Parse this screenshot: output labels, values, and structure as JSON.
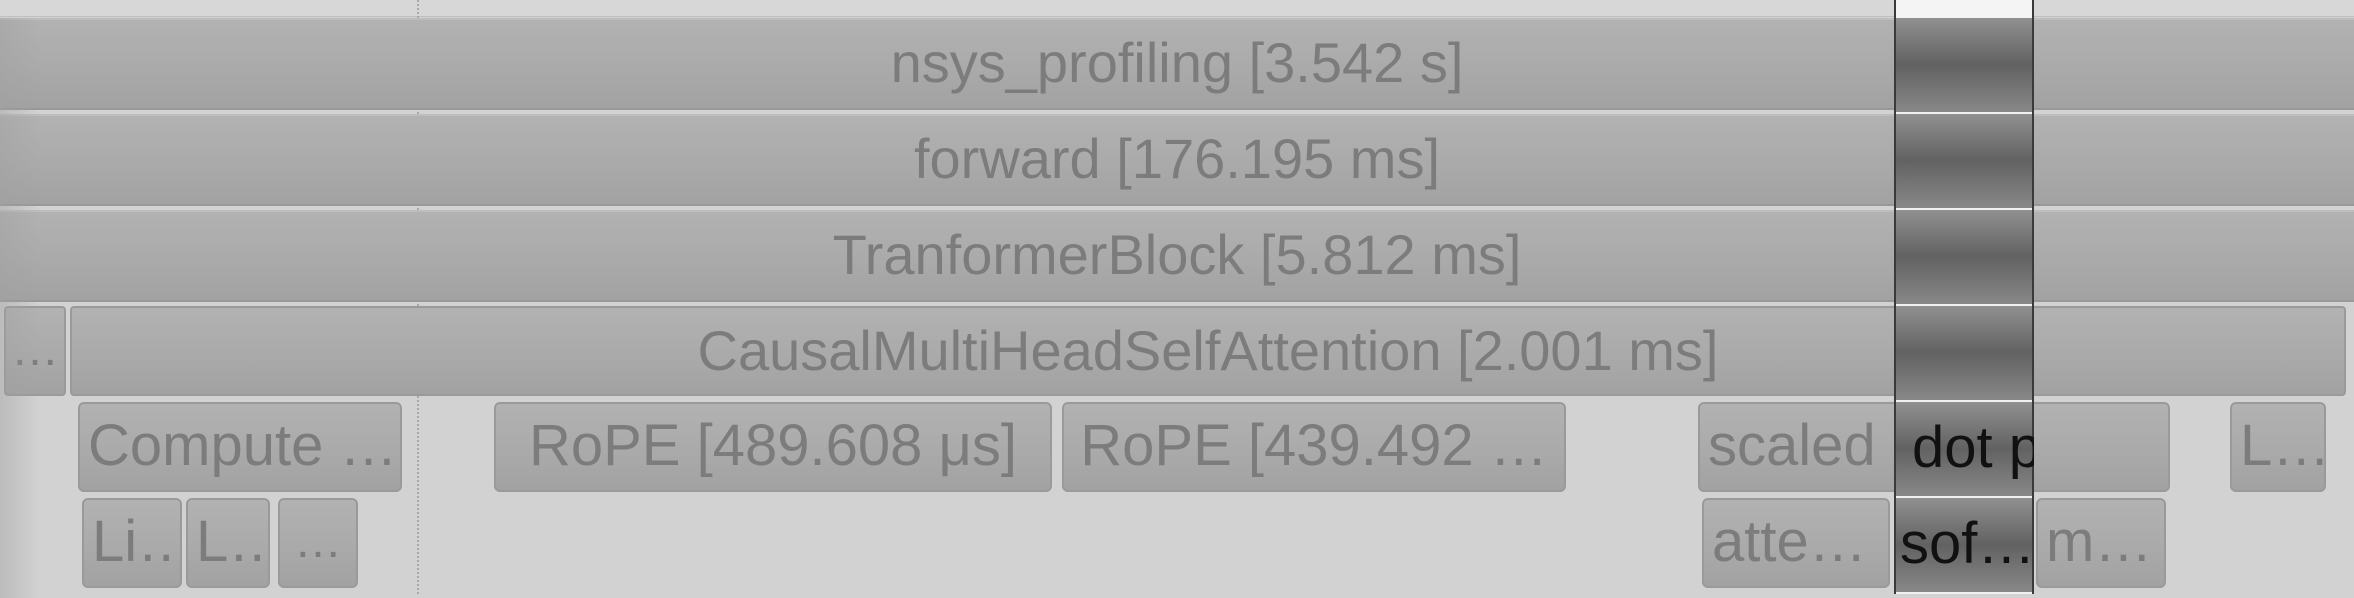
{
  "rows": {
    "nsys_profiling": "nsys_profiling [3.542 s]",
    "forward": "forward [176.195 ms]",
    "transformer_block": "TranformerBlock [5.812 ms]",
    "attention_prefix": "…",
    "attention": "CausalMultiHeadSelfAttention [2.001 ms]"
  },
  "row5": {
    "compute": "Compute …",
    "rope1": "RoPE [489.608 μs]",
    "rope2": "RoPE [439.492 …",
    "scaled_prefix": "scaled",
    "scaled_highlight": "dot pro…",
    "last": "L…"
  },
  "row6": {
    "li": "Li…",
    "l": "L…",
    "ellipsis": "…",
    "atte": "atte…",
    "soft": "sof…",
    "m": "m…"
  }
}
